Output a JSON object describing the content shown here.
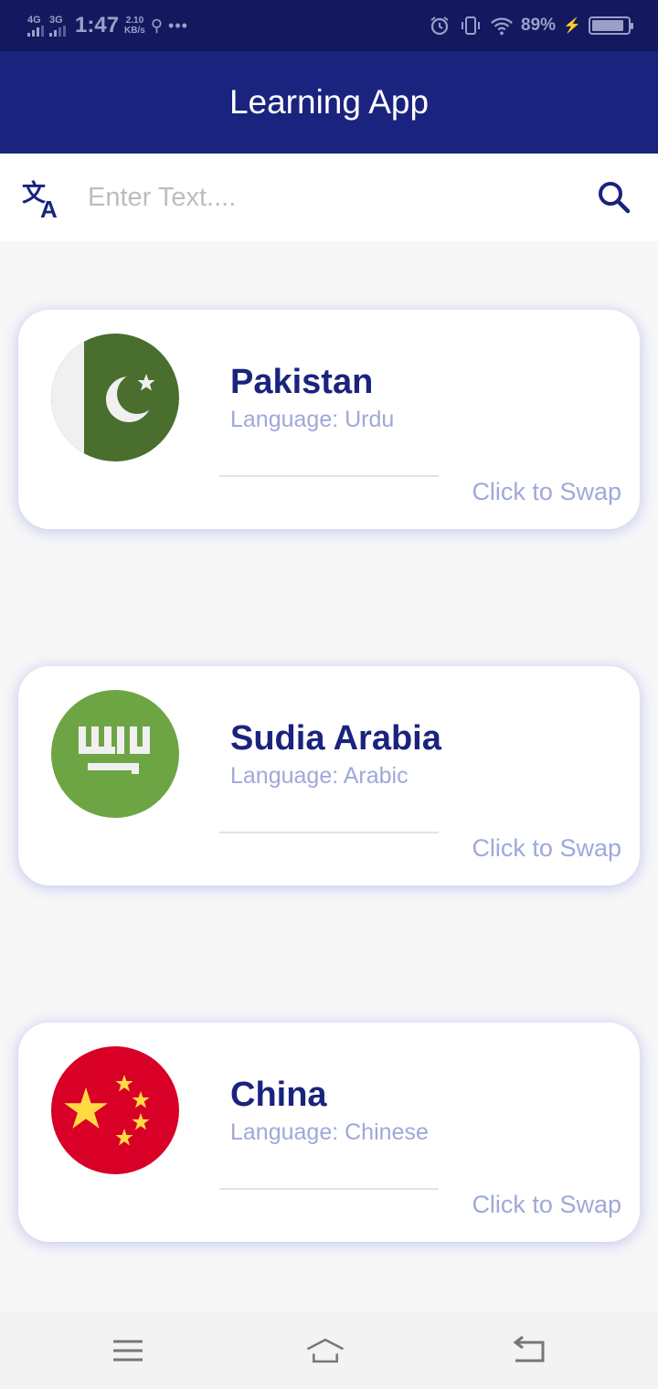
{
  "status_bar": {
    "net1": "4G",
    "net2": "3G",
    "time": "1:47",
    "speed_value": "2.10",
    "speed_unit": "KB/s",
    "battery_percent": "89%",
    "battery_level": 0.89
  },
  "app_bar": {
    "title": "Learning App"
  },
  "search": {
    "placeholder": "Enter Text....",
    "value": "",
    "translate_icon": "translate-icon",
    "search_icon": "search-icon"
  },
  "cards": [
    {
      "country": "Pakistan",
      "language": "Language: Urdu",
      "swap_label": "Click to Swap",
      "flag": "pakistan-flag"
    },
    {
      "country": "Sudia Arabia",
      "language": "Language: Arabic",
      "swap_label": "Click to Swap",
      "flag": "saudi-arabia-flag"
    },
    {
      "country": "China",
      "language": "Language: Chinese",
      "swap_label": "Click to Swap",
      "flag": "china-flag"
    }
  ],
  "colors": {
    "status_bar": "#14195f",
    "app_bar": "#1a237e",
    "accent": "#1a237e",
    "secondary_text": "#9fa8da",
    "pakistan_green": "#496e2d",
    "saudi_green": "#6da544",
    "china_red": "#d80027",
    "china_yellow": "#ffda44"
  },
  "nav_bar": {
    "icons": [
      "menu-icon",
      "home-icon",
      "back-icon"
    ]
  }
}
